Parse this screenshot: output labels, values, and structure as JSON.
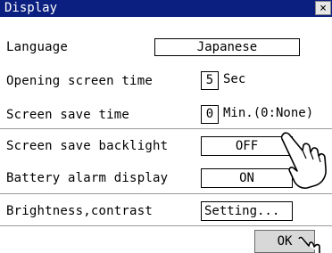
{
  "window": {
    "title": "Display",
    "close_label": "×"
  },
  "rows": {
    "language": {
      "label": "Language",
      "value": "Japanese"
    },
    "opening_screen_time": {
      "label": "Opening screen time",
      "value": "5",
      "unit": "Sec"
    },
    "screen_save_time": {
      "label": "Screen save time",
      "value": "0",
      "unit": "Min.(0:None)"
    },
    "screen_save_backlight": {
      "label": "Screen save backlight",
      "value": "OFF"
    },
    "battery_alarm_display": {
      "label": "Battery alarm display",
      "value": "ON"
    },
    "brightness_contrast": {
      "label": "Brightness,contrast",
      "button": "Setting..."
    }
  },
  "footer": {
    "ok_label": "OK"
  },
  "icons": {
    "pointer": "hand-pointer-icon"
  }
}
